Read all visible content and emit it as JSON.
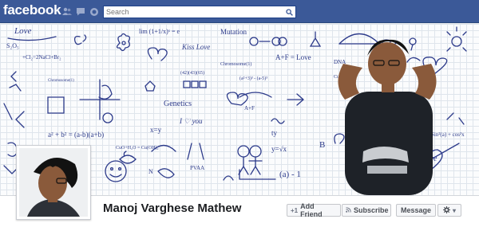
{
  "brand": {
    "name": "facebook",
    "color": "#3b5998"
  },
  "topbar": {
    "jewels": [
      {
        "icon": "friend-requests-icon"
      },
      {
        "icon": "messages-icon"
      },
      {
        "icon": "notifications-icon"
      }
    ],
    "search": {
      "placeholder": "Search",
      "value": ""
    }
  },
  "cover": {
    "doodles": {
      "love_top": "Love",
      "s2o5": "S₂O₅",
      "formula_na": "+Cl₂=2NaCl+Br₂",
      "limit": "lim (1+1/x)ˣ = e",
      "chromosome": "Chromosome(1)",
      "kiss_love": "Kiss Love",
      "mutation": "Mutation",
      "chromosome2": "Chromosome(1)",
      "a_f_love": "A+F = Love",
      "dna": "DNA",
      "expr1": "(a²+3)³ - (a-5)³",
      "expr2": "Cu+H₂O",
      "genetics": "Genetics",
      "a2b2": "a² + b² = (a-b)(a+b)",
      "xy": "x=y",
      "i_love_you": "I ♡ you",
      "cuo": "CuO+H₂O = Cu(OH)₂",
      "ty": "ty",
      "y_sqrt": "y=√x",
      "b": "B",
      "a_minus_1": "(a) - 1",
      "sinx": "Sin²(a) + cos²x",
      "love_right": "Love",
      "pvt": "PVAA",
      "n": "N",
      "a_f": "A+F",
      "numbers": "(42)(43)(65)"
    }
  },
  "profile": {
    "name": "Manoj Varghese Mathew",
    "avatar_icon": "profile-photo"
  },
  "actions": {
    "add_friend": "Add Friend",
    "subscribe": "Subscribe",
    "message": "Message"
  },
  "colors": {
    "ink": "#2c3a8a",
    "grid": "#dfe5ec"
  }
}
